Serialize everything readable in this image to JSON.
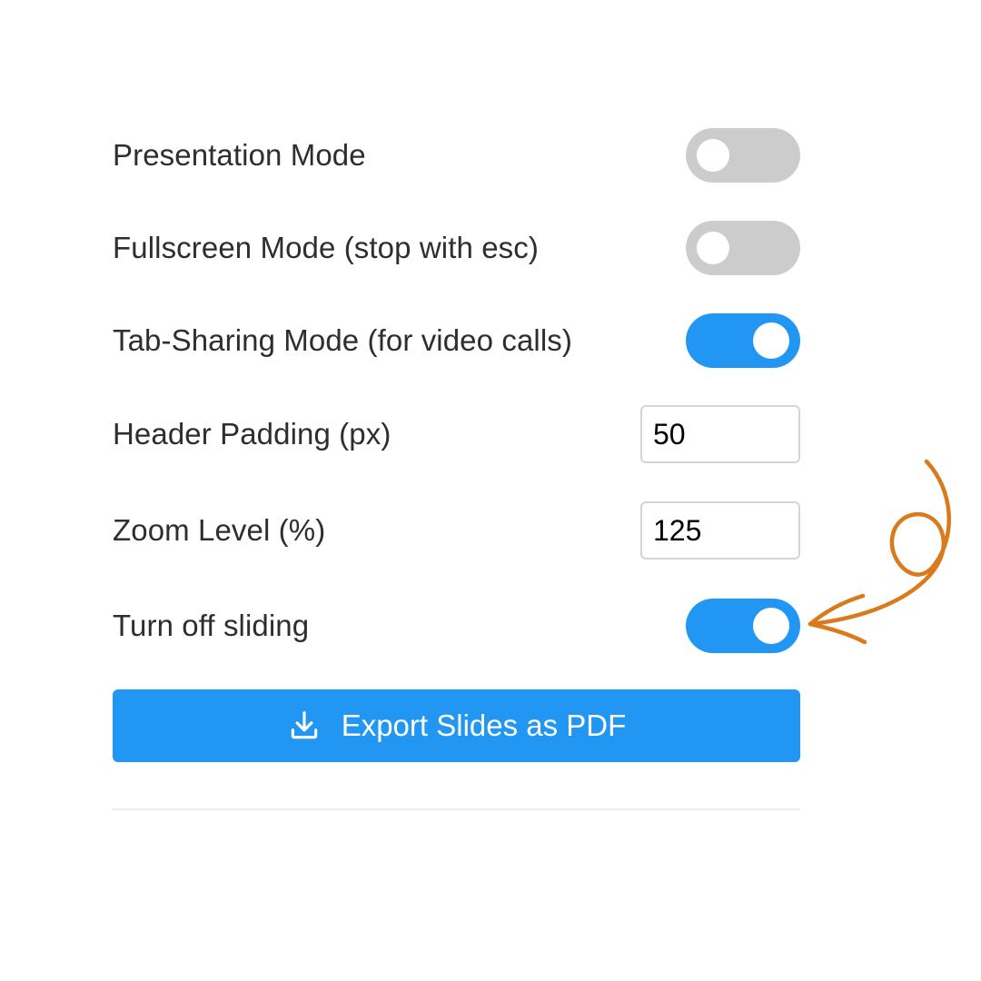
{
  "settings": {
    "presentation_mode": {
      "label": "Presentation Mode",
      "enabled": false
    },
    "fullscreen_mode": {
      "label": "Fullscreen Mode (stop with esc)",
      "enabled": false
    },
    "tab_sharing_mode": {
      "label": "Tab-Sharing Mode (for video calls)",
      "enabled": true
    },
    "header_padding": {
      "label": "Header Padding (px)",
      "value": "50"
    },
    "zoom_level": {
      "label": "Zoom Level (%)",
      "value": "125"
    },
    "turn_off_sliding": {
      "label": "Turn off sliding",
      "enabled": true
    }
  },
  "export_button": {
    "label": "Export Slides as PDF",
    "icon": "download-icon"
  },
  "colors": {
    "accent": "#2196f3",
    "toggle_off": "#cccccc",
    "annotation_arrow": "#d97a1c"
  }
}
